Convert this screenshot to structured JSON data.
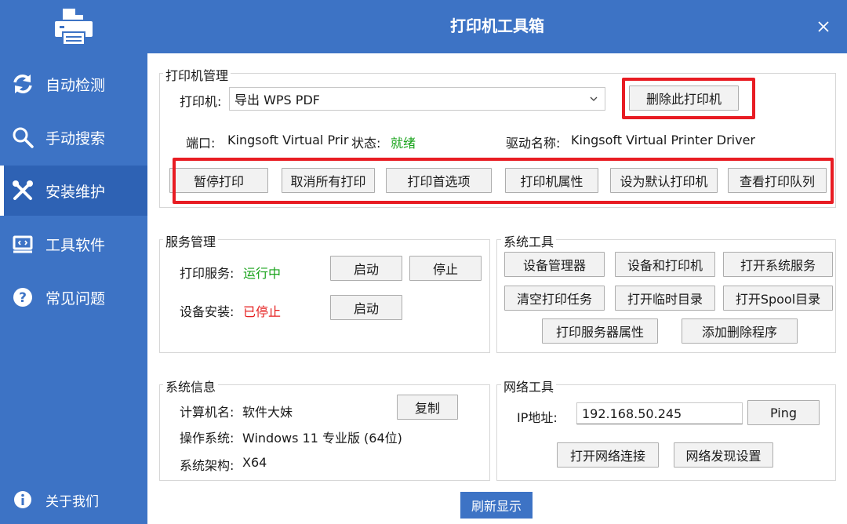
{
  "app": {
    "title": "打印机工具箱"
  },
  "sidebar": {
    "items": [
      {
        "label": "自动检测"
      },
      {
        "label": "手动搜索"
      },
      {
        "label": "安装维护"
      },
      {
        "label": "工具软件"
      },
      {
        "label": "常见问题"
      }
    ],
    "about_label": "关于我们"
  },
  "printer_mgmt": {
    "title": "打印机管理",
    "printer_label": "打印机:",
    "printer_value": "导出 WPS PDF",
    "delete_button": "删除此打印机",
    "port_label": "端口:",
    "port_value": "Kingsoft Virtual Prir",
    "status_label": "状态:",
    "status_value": "就绪",
    "driver_label": "驱动名称:",
    "driver_value": "Kingsoft Virtual Printer Driver",
    "buttons": [
      "暂停打印",
      "取消所有打印",
      "打印首选项",
      "打印机属性",
      "设为默认打印机",
      "查看打印队列"
    ]
  },
  "service_mgmt": {
    "title": "服务管理",
    "print_service_label": "打印服务:",
    "print_service_status": "运行中",
    "start_label": "启动",
    "stop_label": "停止",
    "device_install_label": "设备安装:",
    "device_install_status": "已停止",
    "device_start_label": "启动"
  },
  "system_tools": {
    "title": "系统工具",
    "buttons": [
      "设备管理器",
      "设备和打印机",
      "打开系统服务",
      "清空打印任务",
      "打开临时目录",
      "打开Spool目录",
      "打印服务器属性",
      "添加删除程序"
    ]
  },
  "system_info": {
    "title": "系统信息",
    "computer_label": "计算机名:",
    "computer_value": "软件大妹",
    "copy_button": "复制",
    "os_label": "操作系统:",
    "os_value": "Windows 11 专业版 (64位)",
    "arch_label": "系统架构:",
    "arch_value": "X64"
  },
  "network_tools": {
    "title": "网络工具",
    "ip_label": "IP地址:",
    "ip_value": "192.168.50.245",
    "ping_button": "Ping",
    "open_network_button": "打开网络连接",
    "discovery_button": "网络发现设置"
  },
  "refresh_button": "刷新显示",
  "colors": {
    "accent": "#3d73c5",
    "highlight": "#e81c23",
    "ok": "#19a31b",
    "stopped": "#e52020"
  }
}
